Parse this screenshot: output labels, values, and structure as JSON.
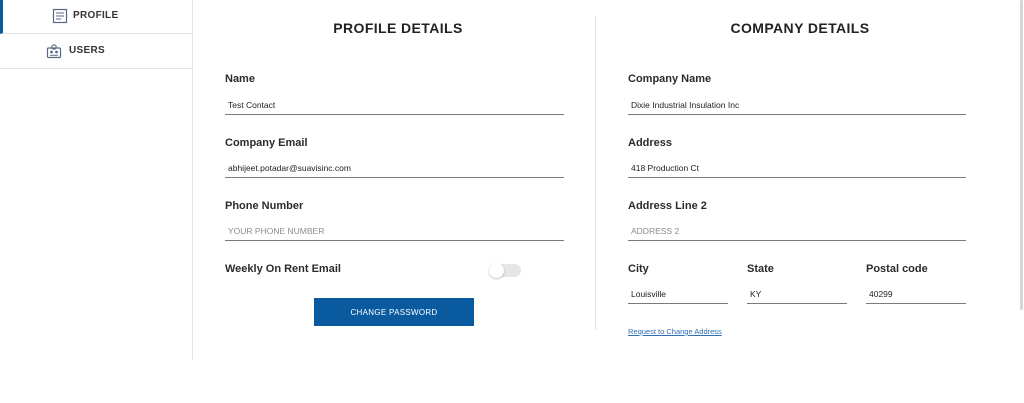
{
  "sidebar": {
    "items": [
      {
        "label": "PROFILE",
        "icon": "profile-card-icon",
        "active": true
      },
      {
        "label": "USERS",
        "icon": "users-icon",
        "active": false
      }
    ]
  },
  "profile": {
    "title": "PROFILE DETAILS",
    "name_label": "Name",
    "name_value": "Test Contact",
    "email_label": "Company Email",
    "email_value": "abhijeet.potadar@suavisinc.com",
    "phone_label": "Phone Number",
    "phone_placeholder": "YOUR PHONE NUMBER",
    "rent_email_label": "Weekly On Rent Email",
    "rent_email_enabled": false,
    "change_password_label": "CHANGE PASSWORD"
  },
  "company": {
    "title": "COMPANY DETAILS",
    "company_name_label": "Company Name",
    "company_name_value": "Dixie Industrial Insulation Inc",
    "address_label": "Address",
    "address_value": "418 Production Ct",
    "address2_label": "Address Line 2",
    "address2_placeholder": "ADDRESS 2",
    "city_label": "City",
    "city_value": "Louisville",
    "state_label": "State",
    "state_value": "KY",
    "postal_label": "Postal code",
    "postal_value": "40299",
    "change_address_link": "Request to Change Address"
  },
  "colors": {
    "accent": "#0a5aa0",
    "link": "#2f6fb5",
    "divider": "#e3e3e3"
  }
}
